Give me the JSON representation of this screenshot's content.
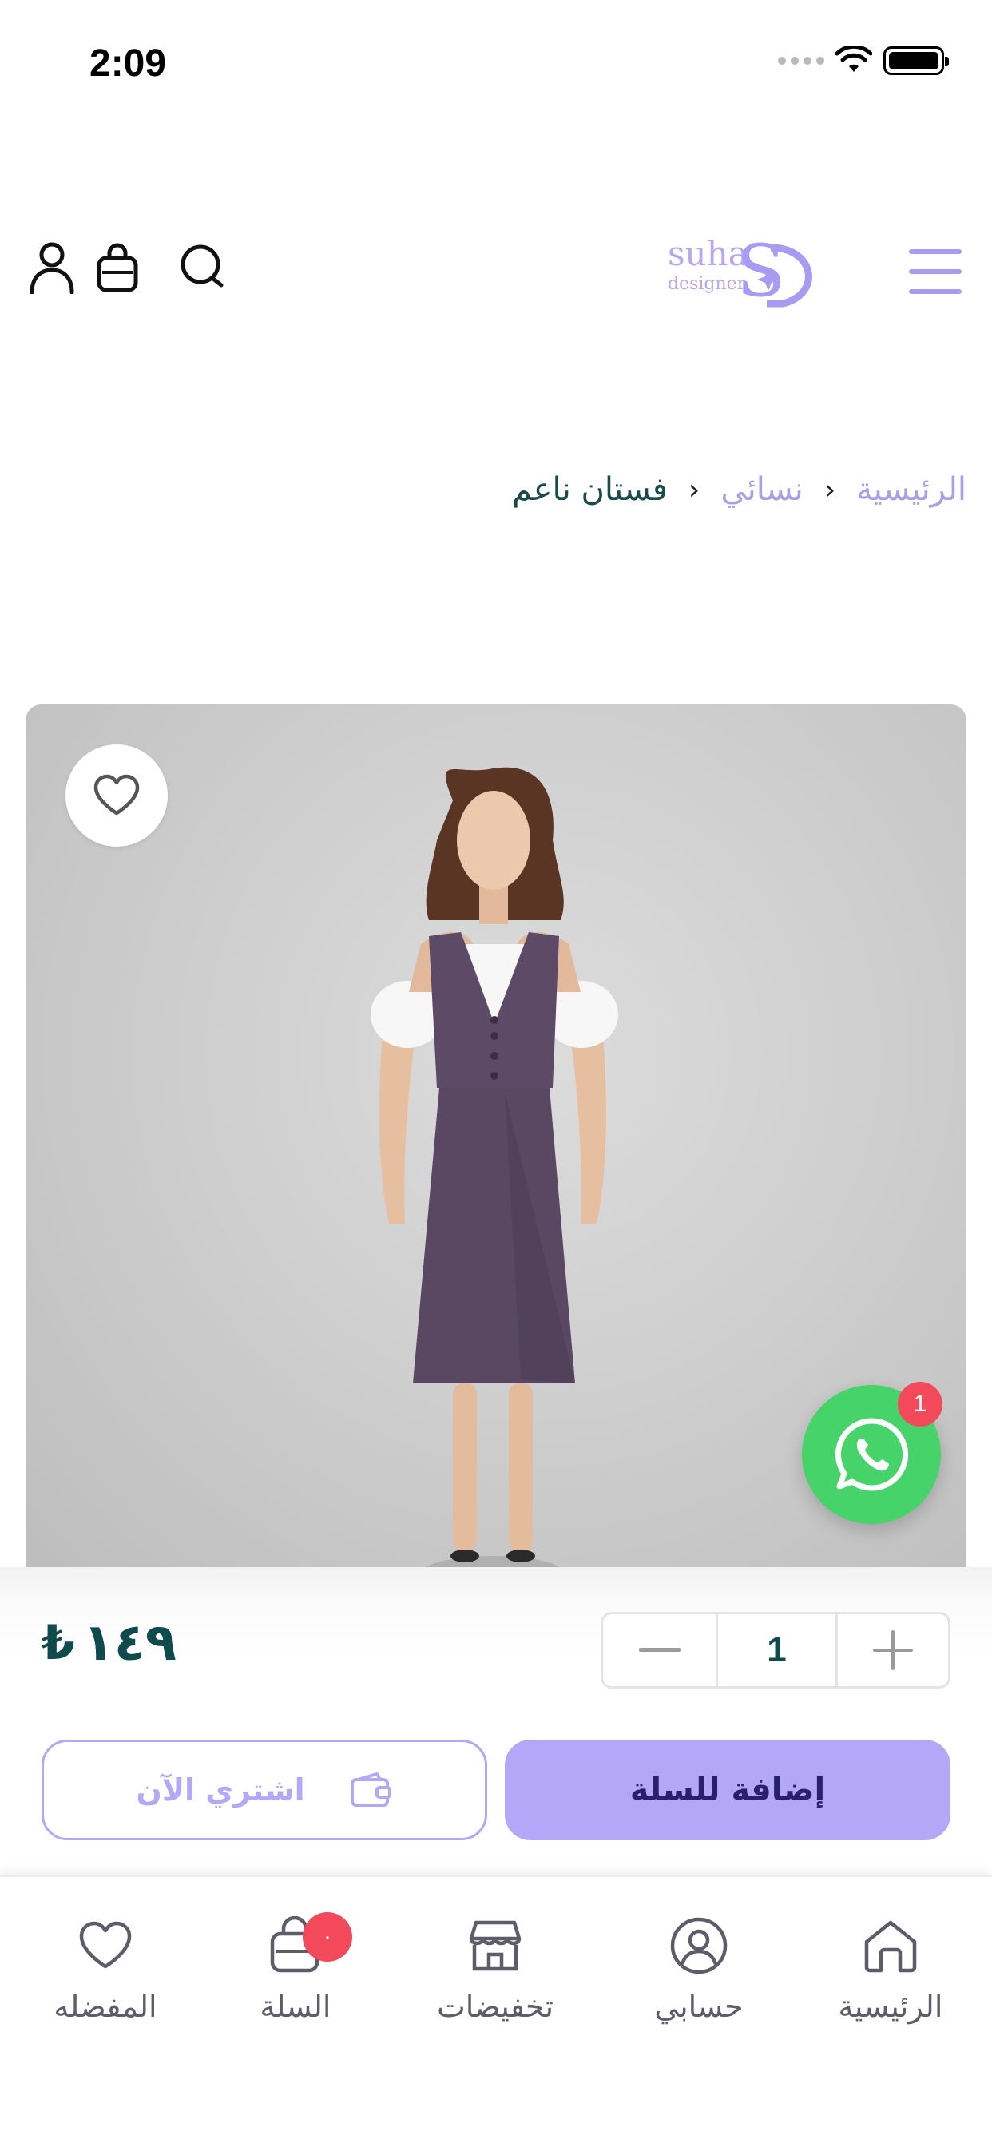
{
  "status_bar": {
    "time": "2:09"
  },
  "header": {
    "logo_text": "suha",
    "logo_subtext": "designer",
    "logo_monogram": "S"
  },
  "breadcrumb": {
    "items": [
      "الرئيسية",
      "نسائي"
    ],
    "current": "فستان ناعم",
    "separator": "›"
  },
  "product": {
    "price_value": "١٤٩",
    "currency_symbol": "₺",
    "quantity": "1",
    "add_to_cart_label": "إضافة للسلة",
    "buy_now_label": "اشتري الآن"
  },
  "whatsapp": {
    "badge": "1"
  },
  "bottom_nav": {
    "items": [
      {
        "label": "الرئيسية",
        "icon": "home-icon"
      },
      {
        "label": "حسابي",
        "icon": "user-circle-icon"
      },
      {
        "label": "تخفيضات",
        "icon": "store-icon"
      },
      {
        "label": "السلة",
        "icon": "cart-icon",
        "badge": "٠"
      },
      {
        "label": "المفضله",
        "icon": "heart-icon"
      }
    ]
  },
  "colors": {
    "accent": "#b4a7f7",
    "accent_text": "#2a1f6e",
    "price_text": "#0f4a4c",
    "breadcrumb_link": "#ab9de8",
    "whatsapp_green": "#45d36a",
    "badge_red": "#f4485b",
    "dress": "#5c4a66"
  }
}
